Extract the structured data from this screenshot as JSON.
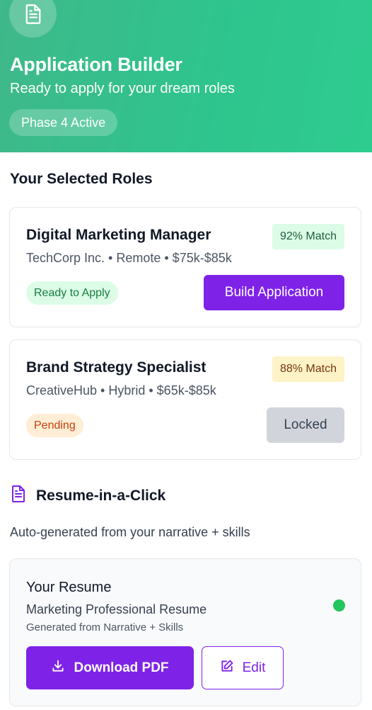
{
  "header": {
    "icon": "document-icon",
    "title": "Application Builder",
    "subtitle": "Ready to apply for your dream roles",
    "phase_badge": "Phase 4 Active",
    "gradient_colors": [
      "#3fb88a",
      "#2ecc8f"
    ]
  },
  "roles_section": {
    "title": "Your Selected Roles",
    "roles": [
      {
        "title": "Digital Marketing Manager",
        "meta": "TechCorp Inc. • Remote • $75k-$85k",
        "match": "92% Match",
        "status": "Ready to Apply",
        "action": "Build Application",
        "match_colors": {
          "bg": "#dcfce7",
          "text": "#1f5f3b"
        },
        "status_colors": {
          "bg": "#dcfce7",
          "text": "#15803d"
        },
        "action_colors": {
          "bg": "#7e22e8",
          "text": "#ffffff"
        }
      },
      {
        "title": "Brand Strategy Specialist",
        "meta": "CreativeHub • Hybrid • $65k-$85k",
        "match": "88% Match",
        "status": "Pending",
        "action": "Locked",
        "match_colors": {
          "bg": "#fef3c7",
          "text": "#78350f"
        },
        "status_colors": {
          "bg": "#ffedd5",
          "text": "#c2410c"
        },
        "action_colors": {
          "bg": "#d1d5db",
          "text": "#374151"
        }
      }
    ]
  },
  "resume_section": {
    "icon": "document-icon",
    "title": "Resume-in-a-Click",
    "description": "Auto-generated from your narrative + skills",
    "card": {
      "title": "Your Resume",
      "name": "Marketing Professional Resume",
      "source": "Generated from Narrative + Skills",
      "status_color": "#22c55e",
      "download_label": "Download PDF",
      "download_icon": "download-icon",
      "edit_label": "Edit",
      "edit_icon": "edit-icon"
    }
  },
  "accent_color": "#7e22e8"
}
